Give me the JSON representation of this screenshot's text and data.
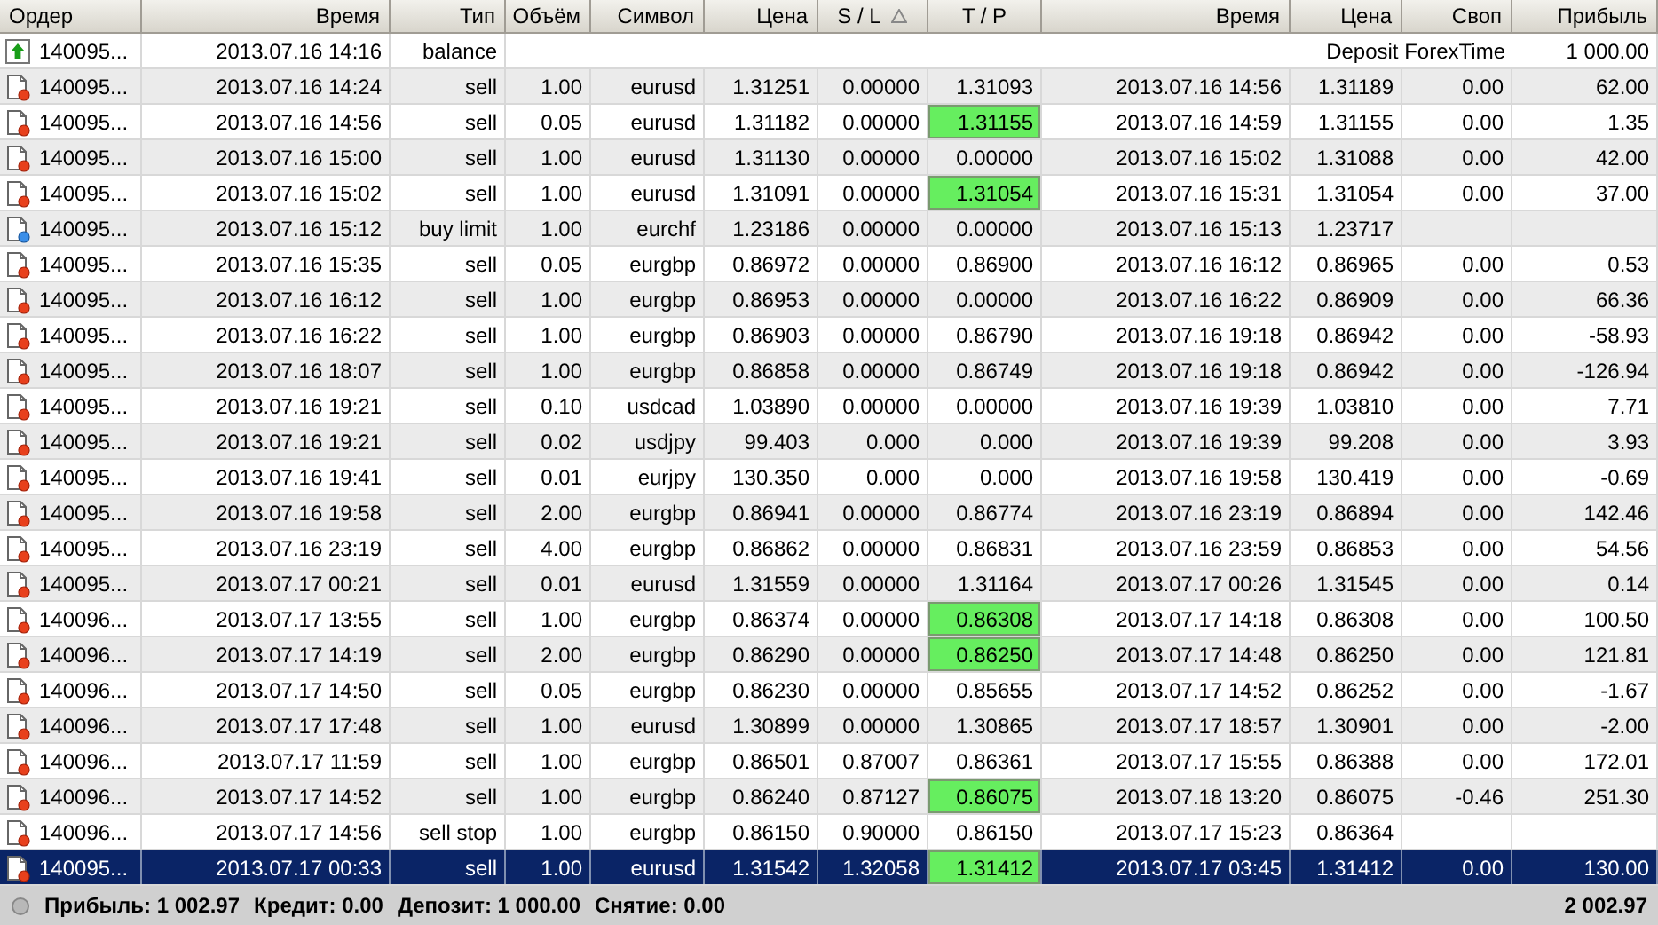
{
  "table": {
    "columns": [
      {
        "label": "Ордер",
        "sorted": false
      },
      {
        "label": "Время",
        "sorted": false
      },
      {
        "label": "Тип",
        "sorted": false
      },
      {
        "label": "Объём",
        "sorted": false
      },
      {
        "label": "Символ",
        "sorted": false
      },
      {
        "label": "Цена",
        "sorted": false
      },
      {
        "label": "S / L",
        "sorted": true
      },
      {
        "label": "T / P",
        "sorted": false
      },
      {
        "label": "Время",
        "sorted": false
      },
      {
        "label": "Цена",
        "sorted": false
      },
      {
        "label": "Своп",
        "sorted": false
      },
      {
        "label": "Прибыль",
        "sorted": false
      }
    ],
    "rows": [
      {
        "kind": "balance",
        "selected": false,
        "order": "140095...",
        "time": "2013.07.16 14:16",
        "type": "balance",
        "comment": "Deposit ForexTime",
        "profit": "1 000.00"
      },
      {
        "kind": "sell",
        "selected": false,
        "tp_hit": false,
        "order": "140095...",
        "time": "2013.07.16 14:24",
        "type": "sell",
        "volume": "1.00",
        "symbol": "eurusd",
        "price": "1.31251",
        "sl": "0.00000",
        "tp": "1.31093",
        "close_time": "2013.07.16 14:56",
        "close_price": "1.31189",
        "swap": "0.00",
        "profit": "62.00"
      },
      {
        "kind": "sell",
        "selected": false,
        "tp_hit": true,
        "order": "140095...",
        "time": "2013.07.16 14:56",
        "type": "sell",
        "volume": "0.05",
        "symbol": "eurusd",
        "price": "1.31182",
        "sl": "0.00000",
        "tp": "1.31155",
        "close_time": "2013.07.16 14:59",
        "close_price": "1.31155",
        "swap": "0.00",
        "profit": "1.35"
      },
      {
        "kind": "sell",
        "selected": false,
        "tp_hit": false,
        "order": "140095...",
        "time": "2013.07.16 15:00",
        "type": "sell",
        "volume": "1.00",
        "symbol": "eurusd",
        "price": "1.31130",
        "sl": "0.00000",
        "tp": "0.00000",
        "close_time": "2013.07.16 15:02",
        "close_price": "1.31088",
        "swap": "0.00",
        "profit": "42.00"
      },
      {
        "kind": "sell",
        "selected": false,
        "tp_hit": true,
        "order": "140095...",
        "time": "2013.07.16 15:02",
        "type": "sell",
        "volume": "1.00",
        "symbol": "eurusd",
        "price": "1.31091",
        "sl": "0.00000",
        "tp": "1.31054",
        "close_time": "2013.07.16 15:31",
        "close_price": "1.31054",
        "swap": "0.00",
        "profit": "37.00"
      },
      {
        "kind": "buy",
        "selected": false,
        "tp_hit": false,
        "order": "140095...",
        "time": "2013.07.16 15:12",
        "type": "buy limit",
        "volume": "1.00",
        "symbol": "eurchf",
        "price": "1.23186",
        "sl": "0.00000",
        "tp": "0.00000",
        "close_time": "2013.07.16 15:13",
        "close_price": "1.23717"
      },
      {
        "kind": "sell",
        "selected": false,
        "tp_hit": false,
        "order": "140095...",
        "time": "2013.07.16 15:35",
        "type": "sell",
        "volume": "0.05",
        "symbol": "eurgbp",
        "price": "0.86972",
        "sl": "0.00000",
        "tp": "0.86900",
        "close_time": "2013.07.16 16:12",
        "close_price": "0.86965",
        "swap": "0.00",
        "profit": "0.53"
      },
      {
        "kind": "sell",
        "selected": false,
        "tp_hit": false,
        "order": "140095...",
        "time": "2013.07.16 16:12",
        "type": "sell",
        "volume": "1.00",
        "symbol": "eurgbp",
        "price": "0.86953",
        "sl": "0.00000",
        "tp": "0.00000",
        "close_time": "2013.07.16 16:22",
        "close_price": "0.86909",
        "swap": "0.00",
        "profit": "66.36"
      },
      {
        "kind": "sell",
        "selected": false,
        "tp_hit": false,
        "order": "140095...",
        "time": "2013.07.16 16:22",
        "type": "sell",
        "volume": "1.00",
        "symbol": "eurgbp",
        "price": "0.86903",
        "sl": "0.00000",
        "tp": "0.86790",
        "close_time": "2013.07.16 19:18",
        "close_price": "0.86942",
        "swap": "0.00",
        "profit": "-58.93"
      },
      {
        "kind": "sell",
        "selected": false,
        "tp_hit": false,
        "order": "140095...",
        "time": "2013.07.16 18:07",
        "type": "sell",
        "volume": "1.00",
        "symbol": "eurgbp",
        "price": "0.86858",
        "sl": "0.00000",
        "tp": "0.86749",
        "close_time": "2013.07.16 19:18",
        "close_price": "0.86942",
        "swap": "0.00",
        "profit": "-126.94"
      },
      {
        "kind": "sell",
        "selected": false,
        "tp_hit": false,
        "order": "140095...",
        "time": "2013.07.16 19:21",
        "type": "sell",
        "volume": "0.10",
        "symbol": "usdcad",
        "price": "1.03890",
        "sl": "0.00000",
        "tp": "0.00000",
        "close_time": "2013.07.16 19:39",
        "close_price": "1.03810",
        "swap": "0.00",
        "profit": "7.71"
      },
      {
        "kind": "sell",
        "selected": false,
        "tp_hit": false,
        "order": "140095...",
        "time": "2013.07.16 19:21",
        "type": "sell",
        "volume": "0.02",
        "symbol": "usdjpy",
        "price": "99.403",
        "sl": "0.000",
        "tp": "0.000",
        "close_time": "2013.07.16 19:39",
        "close_price": "99.208",
        "swap": "0.00",
        "profit": "3.93"
      },
      {
        "kind": "sell",
        "selected": false,
        "tp_hit": false,
        "order": "140095...",
        "time": "2013.07.16 19:41",
        "type": "sell",
        "volume": "0.01",
        "symbol": "eurjpy",
        "price": "130.350",
        "sl": "0.000",
        "tp": "0.000",
        "close_time": "2013.07.16 19:58",
        "close_price": "130.419",
        "swap": "0.00",
        "profit": "-0.69"
      },
      {
        "kind": "sell",
        "selected": false,
        "tp_hit": false,
        "order": "140095...",
        "time": "2013.07.16 19:58",
        "type": "sell",
        "volume": "2.00",
        "symbol": "eurgbp",
        "price": "0.86941",
        "sl": "0.00000",
        "tp": "0.86774",
        "close_time": "2013.07.16 23:19",
        "close_price": "0.86894",
        "swap": "0.00",
        "profit": "142.46"
      },
      {
        "kind": "sell",
        "selected": false,
        "tp_hit": false,
        "order": "140095...",
        "time": "2013.07.16 23:19",
        "type": "sell",
        "volume": "4.00",
        "symbol": "eurgbp",
        "price": "0.86862",
        "sl": "0.00000",
        "tp": "0.86831",
        "close_time": "2013.07.16 23:59",
        "close_price": "0.86853",
        "swap": "0.00",
        "profit": "54.56"
      },
      {
        "kind": "sell",
        "selected": false,
        "tp_hit": false,
        "order": "140095...",
        "time": "2013.07.17 00:21",
        "type": "sell",
        "volume": "0.01",
        "symbol": "eurusd",
        "price": "1.31559",
        "sl": "0.00000",
        "tp": "1.31164",
        "close_time": "2013.07.17 00:26",
        "close_price": "1.31545",
        "swap": "0.00",
        "profit": "0.14"
      },
      {
        "kind": "sell",
        "selected": false,
        "tp_hit": true,
        "order": "140096...",
        "time": "2013.07.17 13:55",
        "type": "sell",
        "volume": "1.00",
        "symbol": "eurgbp",
        "price": "0.86374",
        "sl": "0.00000",
        "tp": "0.86308",
        "close_time": "2013.07.17 14:18",
        "close_price": "0.86308",
        "swap": "0.00",
        "profit": "100.50"
      },
      {
        "kind": "sell",
        "selected": false,
        "tp_hit": true,
        "order": "140096...",
        "time": "2013.07.17 14:19",
        "type": "sell",
        "volume": "2.00",
        "symbol": "eurgbp",
        "price": "0.86290",
        "sl": "0.00000",
        "tp": "0.86250",
        "close_time": "2013.07.17 14:48",
        "close_price": "0.86250",
        "swap": "0.00",
        "profit": "121.81"
      },
      {
        "kind": "sell",
        "selected": false,
        "tp_hit": false,
        "order": "140096...",
        "time": "2013.07.17 14:50",
        "type": "sell",
        "volume": "0.05",
        "symbol": "eurgbp",
        "price": "0.86230",
        "sl": "0.00000",
        "tp": "0.85655",
        "close_time": "2013.07.17 14:52",
        "close_price": "0.86252",
        "swap": "0.00",
        "profit": "-1.67"
      },
      {
        "kind": "sell",
        "selected": false,
        "tp_hit": false,
        "order": "140096...",
        "time": "2013.07.17 17:48",
        "type": "sell",
        "volume": "1.00",
        "symbol": "eurusd",
        "price": "1.30899",
        "sl": "0.00000",
        "tp": "1.30865",
        "close_time": "2013.07.17 18:57",
        "close_price": "1.30901",
        "swap": "0.00",
        "profit": "-2.00"
      },
      {
        "kind": "sell",
        "selected": false,
        "tp_hit": false,
        "order": "140096...",
        "time": "2013.07.17 11:59",
        "type": "sell",
        "volume": "1.00",
        "symbol": "eurgbp",
        "price": "0.86501",
        "sl": "0.87007",
        "tp": "0.86361",
        "close_time": "2013.07.17 15:55",
        "close_price": "0.86388",
        "swap": "0.00",
        "profit": "172.01"
      },
      {
        "kind": "sell",
        "selected": false,
        "tp_hit": true,
        "order": "140096...",
        "time": "2013.07.17 14:52",
        "type": "sell",
        "volume": "1.00",
        "symbol": "eurgbp",
        "price": "0.86240",
        "sl": "0.87127",
        "tp": "0.86075",
        "close_time": "2013.07.18 13:20",
        "close_price": "0.86075",
        "swap": "-0.46",
        "profit": "251.30"
      },
      {
        "kind": "sell",
        "selected": false,
        "tp_hit": false,
        "order": "140096...",
        "time": "2013.07.17 14:56",
        "type": "sell stop",
        "volume": "1.00",
        "symbol": "eurgbp",
        "price": "0.86150",
        "sl": "0.90000",
        "tp": "0.86150",
        "close_time": "2013.07.17 15:23",
        "close_price": "0.86364"
      },
      {
        "kind": "sell",
        "selected": true,
        "tp_hit": true,
        "order": "140095...",
        "time": "2013.07.17 00:33",
        "type": "sell",
        "volume": "1.00",
        "symbol": "eurusd",
        "price": "1.31542",
        "sl": "1.32058",
        "tp": "1.31412",
        "close_time": "2013.07.17 03:45",
        "close_price": "1.31412",
        "swap": "0.00",
        "profit": "130.00"
      }
    ]
  },
  "status_bar": {
    "summary": [
      "Прибыль: 1 002.97",
      "Кредит: 0.00",
      "Депозит: 1 000.00",
      "Снятие: 0.00"
    ],
    "total": "2 002.97"
  }
}
